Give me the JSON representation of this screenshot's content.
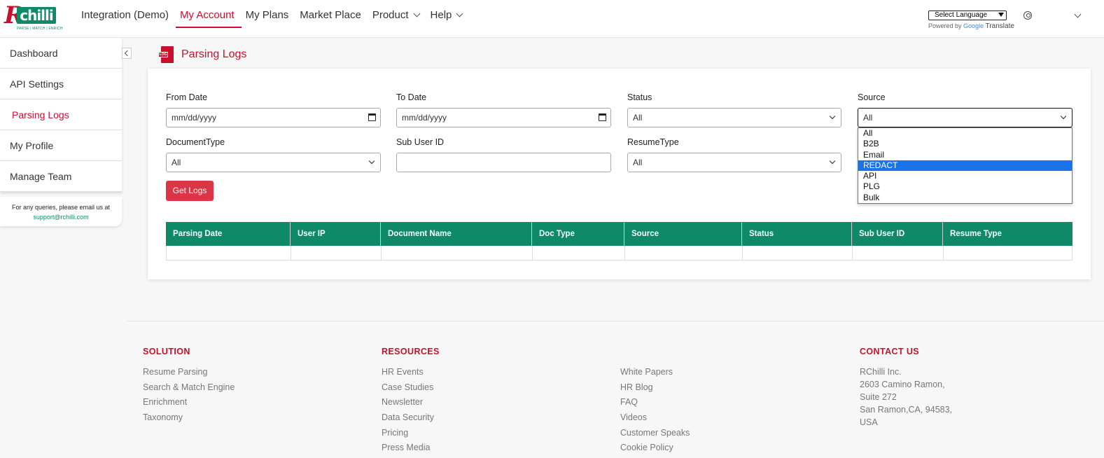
{
  "brand": {
    "name": "RChilli",
    "tagline": "PARSE | MATCH | ENRICH"
  },
  "nav": {
    "items": [
      {
        "label": "Integration (Demo)"
      },
      {
        "label": "My Account"
      },
      {
        "label": "My Plans"
      },
      {
        "label": "Market Place"
      },
      {
        "label": "Product"
      },
      {
        "label": "Help"
      }
    ],
    "language_select": "Select Language",
    "powered_by": "Powered by",
    "google": "Google",
    "translate": "Translate"
  },
  "sidebar": {
    "items": [
      {
        "label": "Dashboard"
      },
      {
        "label": "API Settings"
      },
      {
        "label": "Parsing Logs"
      },
      {
        "label": "My Profile"
      },
      {
        "label": "Manage Team"
      }
    ],
    "query_text": "For any queries, please email us at",
    "query_email": "support@rchilli.com"
  },
  "page": {
    "title": "Parsing Logs",
    "icon_label": "LOG"
  },
  "filters": {
    "from_date": {
      "label": "From Date",
      "placeholder": "mm/dd/yyyy"
    },
    "to_date": {
      "label": "To Date",
      "placeholder": "mm/dd/yyyy"
    },
    "status": {
      "label": "Status",
      "value": "All"
    },
    "source": {
      "label": "Source",
      "value": "All"
    },
    "document_type": {
      "label": "DocumentType",
      "value": "All"
    },
    "sub_user_id": {
      "label": "Sub User ID",
      "value": ""
    },
    "resume_type": {
      "label": "ResumeType",
      "value": "All"
    },
    "submit": "Get Logs"
  },
  "source_options": {
    "options": [
      "All",
      "B2B",
      "Email",
      "REDACT",
      "API",
      "PLG",
      "Bulk"
    ],
    "highlighted": "REDACT"
  },
  "table": {
    "columns": [
      "Parsing Date",
      "User IP",
      "Document Name",
      "Doc Type",
      "Source",
      "Status",
      "Sub User ID",
      "Resume Type"
    ]
  },
  "footer": {
    "solution": {
      "title": "SOLUTION",
      "links": [
        "Resume Parsing",
        "Search & Match Engine",
        "Enrichment",
        "Taxonomy"
      ]
    },
    "resources": {
      "title": "RESOURCES",
      "links": [
        "HR Events",
        "Case Studies",
        "Newsletter",
        "Data Security",
        "Pricing",
        "Press Media"
      ]
    },
    "more": {
      "links": [
        "White Papers",
        "HR Blog",
        "FAQ",
        "Videos",
        "Customer Speaks",
        "Cookie Policy"
      ]
    },
    "contact": {
      "title": "CONTACT US",
      "lines": [
        "RChilli Inc.",
        "2603 Camino Ramon,",
        "Suite 272",
        "San Ramon,CA, 94583,",
        "USA"
      ]
    }
  },
  "colors": {
    "brand_red": "#c8102e",
    "brand_green": "#0f8a68",
    "button_red": "#dc3545",
    "highlight_blue": "#1a73e8"
  }
}
